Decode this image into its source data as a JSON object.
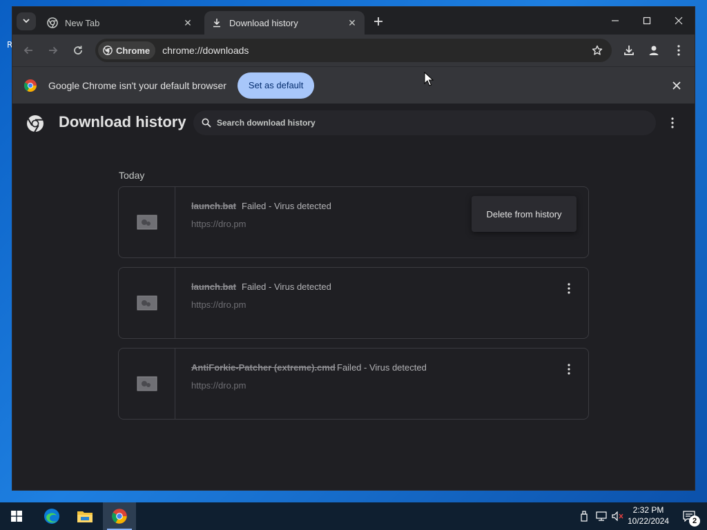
{
  "browser": {
    "tabs": [
      {
        "label": "New Tab",
        "active": false
      },
      {
        "label": "Download history",
        "active": true
      }
    ],
    "omnibox": {
      "chip_label": "Chrome",
      "url": "chrome://downloads"
    }
  },
  "infobar": {
    "message": "Google Chrome isn't your default browser",
    "button_label": "Set as default"
  },
  "page": {
    "title": "Download history",
    "search_placeholder": "Search download history",
    "section_label": "Today",
    "context_menu_item": "Delete from history",
    "downloads": [
      {
        "filename": "launch.bat",
        "status": "Failed - Virus detected",
        "source": "https://dro.pm"
      },
      {
        "filename": "launch.bat",
        "status": "Failed - Virus detected",
        "source": "https://dro.pm"
      },
      {
        "filename": "AntiForkie-Patcher (extreme).cmd",
        "status": "Failed - Virus detected",
        "source": "https://dro.pm"
      }
    ]
  },
  "taskbar": {
    "time": "2:32 PM",
    "date": "10/22/2024",
    "notification_count": "2"
  },
  "colors": {
    "accent": "#a8c7fa",
    "page_bg": "#1f1f23",
    "toolbar_bg": "#35363a"
  }
}
